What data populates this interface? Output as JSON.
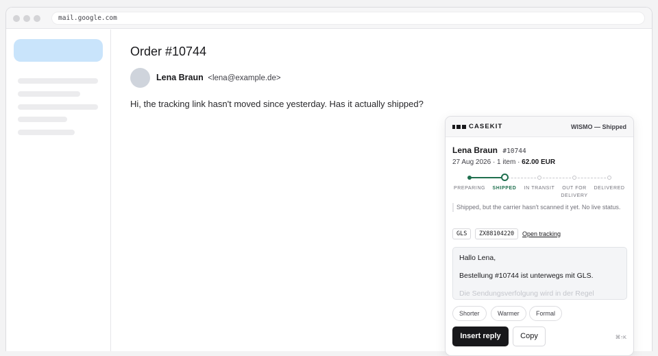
{
  "browser": {
    "url": "mail.google.com"
  },
  "email": {
    "subject": "Order #10744",
    "sender_name": "Lena Braun",
    "sender_email": "<lena@example.de>",
    "body": "Hi, the tracking link hasn't moved since yesterday. Has it actually shipped?"
  },
  "panel": {
    "brand": "CASEKIT",
    "status_tag": "WISMO — Shipped",
    "customer_name": "Lena Braun",
    "order_number": "#10744",
    "order_meta": "27 Aug 2026 · 1 item · ",
    "order_total": "62.00 EUR",
    "progress": {
      "current_step_index": 1,
      "steps": [
        {
          "label": "PREPARING",
          "state": "done"
        },
        {
          "label": "SHIPPED",
          "state": "current"
        },
        {
          "label": "IN TRANSIT",
          "state": "todo"
        },
        {
          "label": "OUT FOR DELIVERY",
          "state": "todo"
        },
        {
          "label": "DELIVERED",
          "state": "todo"
        }
      ]
    },
    "status_note": "Shipped, but the carrier hasn't scanned it yet. No live status.",
    "carrier": "GLS",
    "tracking_number": "ZX88104220",
    "tracking_link": "Open tracking",
    "draft": {
      "greeting": "Hallo Lena,",
      "line1": "Bestellung #10744 ist unterwegs mit GLS.",
      "line2": "Die Sendungsverfolgung wird in der Regel"
    },
    "tone_options": [
      "Shorter",
      "Warmer",
      "Formal"
    ],
    "insert_label": "Insert reply",
    "copy_label": "Copy",
    "shortcut": "⌘↑K"
  },
  "colors": {
    "accent_green": "#1f6f4e",
    "primary_button": "#18181b",
    "compose_blue": "#c9e4fb"
  }
}
